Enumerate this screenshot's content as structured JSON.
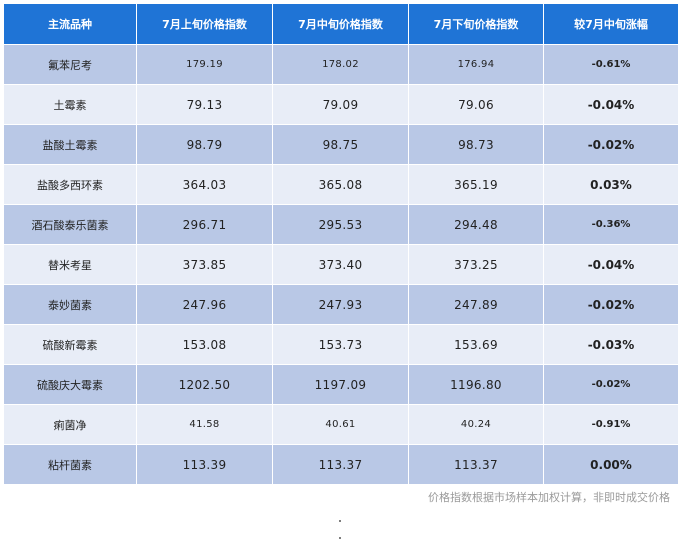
{
  "table": {
    "headers": [
      "主流品种",
      "7月上旬价格指数",
      "7月中旬价格指数",
      "7月下旬价格指数",
      "较7月中旬涨幅"
    ],
    "rows": [
      {
        "name": "氟苯尼考",
        "early": "179.19",
        "mid": "178.02",
        "late": "176.94",
        "change": "-0.61%",
        "trend": "down"
      },
      {
        "name": "土霉素",
        "early": "79.13",
        "mid": "79.09",
        "late": "79.06",
        "change": "-0.04%",
        "trend": "down"
      },
      {
        "name": "盐酸土霉素",
        "early": "98.79",
        "mid": "98.75",
        "late": "98.73",
        "change": "-0.02%",
        "trend": "down"
      },
      {
        "name": "盐酸多西环素",
        "early": "364.03",
        "mid": "365.08",
        "late": "365.19",
        "change": "0.03%",
        "trend": "up"
      },
      {
        "name": "酒石酸泰乐菌素",
        "early": "296.71",
        "mid": "295.53",
        "late": "294.48",
        "change": "-0.36%",
        "trend": "down"
      },
      {
        "name": "替米考星",
        "early": "373.85",
        "mid": "373.40",
        "late": "373.25",
        "change": "-0.04%",
        "trend": "down"
      },
      {
        "name": "泰妙菌素",
        "early": "247.96",
        "mid": "247.93",
        "late": "247.89",
        "change": "-0.02%",
        "trend": "down"
      },
      {
        "name": "硫酸新霉素",
        "early": "153.08",
        "mid": "153.73",
        "late": "153.69",
        "change": "-0.03%",
        "trend": "down"
      },
      {
        "name": "硫酸庆大霉素",
        "early": "1202.50",
        "mid": "1197.09",
        "late": "1196.80",
        "change": "-0.02%",
        "trend": "down"
      },
      {
        "name": "痢菌净",
        "early": "41.58",
        "mid": "40.61",
        "late": "40.24",
        "change": "-0.91%",
        "trend": "down"
      },
      {
        "name": "粘杆菌素",
        "early": "113.39",
        "mid": "113.37",
        "late": "113.37",
        "change": "0.00%",
        "trend": "flat"
      }
    ]
  },
  "footnote": "价格指数根据市场样本加权计算，非即时成交价格",
  "colors": {
    "header_bg": "#1f74d6",
    "row_dark": "#b9c8e6",
    "row_light": "#e8edf7",
    "negative": "#2e7d1b",
    "positive": "#e0172f",
    "flat": "#9a9a9a"
  }
}
